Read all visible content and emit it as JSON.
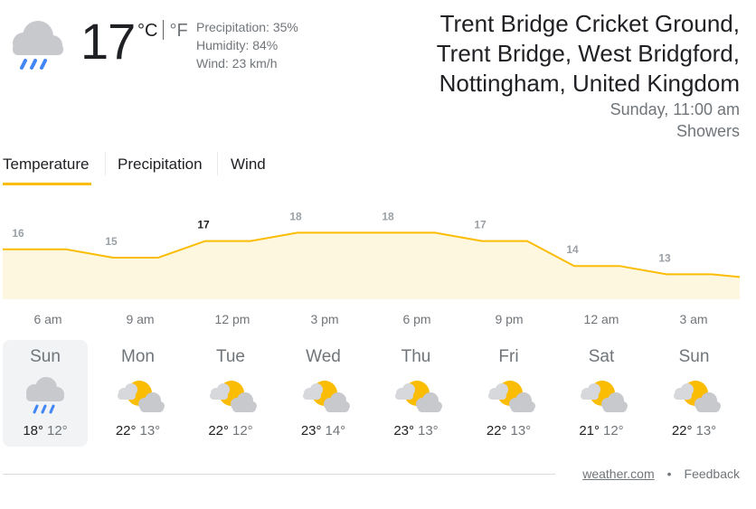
{
  "current": {
    "icon": "rain-cloud-icon",
    "temperature": "17",
    "unit_c": "°C",
    "unit_f": "°F",
    "precipitation": "Precipitation: 35%",
    "humidity": "Humidity: 84%",
    "wind": "Wind: 23 km/h"
  },
  "location": {
    "line1": "Trent Bridge Cricket Ground,",
    "line2": "Trent Bridge, West Bridgford,",
    "line3": "Nottingham, United Kingdom",
    "time": "Sunday, 11:00 am",
    "condition": "Showers"
  },
  "tabs": [
    {
      "label": "Temperature",
      "active": true
    },
    {
      "label": "Precipitation",
      "active": false
    },
    {
      "label": "Wind",
      "active": false
    }
  ],
  "chart_data": {
    "type": "area",
    "x": [
      "6 am",
      "9 am",
      "12 pm",
      "3 pm",
      "6 pm",
      "9 pm",
      "12 am",
      "3 am"
    ],
    "values": [
      16,
      15,
      17,
      18,
      18,
      17,
      14,
      13
    ],
    "value_labels": [
      "16",
      "15",
      "17",
      "18",
      "18",
      "17",
      "14",
      "13"
    ],
    "ylim": [
      10,
      19
    ],
    "line_color": "#fbbc04",
    "fill_color": "#fef7e0"
  },
  "forecast": [
    {
      "day": "Sun",
      "icon": "rain-cloud-icon",
      "high": "18°",
      "low": "12°",
      "selected": true
    },
    {
      "day": "Mon",
      "icon": "partly-sunny-icon",
      "high": "22°",
      "low": "13°",
      "selected": false
    },
    {
      "day": "Tue",
      "icon": "partly-sunny-icon",
      "high": "22°",
      "low": "12°",
      "selected": false
    },
    {
      "day": "Wed",
      "icon": "partly-sunny-icon",
      "high": "23°",
      "low": "14°",
      "selected": false
    },
    {
      "day": "Thu",
      "icon": "partly-sunny-icon",
      "high": "23°",
      "low": "13°",
      "selected": false
    },
    {
      "day": "Fri",
      "icon": "partly-sunny-icon",
      "high": "22°",
      "low": "13°",
      "selected": false
    },
    {
      "day": "Sat",
      "icon": "partly-sunny-icon",
      "high": "21°",
      "low": "12°",
      "selected": false
    },
    {
      "day": "Sun",
      "icon": "partly-sunny-icon",
      "high": "22°",
      "low": "13°",
      "selected": false
    }
  ],
  "footer": {
    "source": "weather.com",
    "separator": "•",
    "feedback": "Feedback"
  },
  "colors": {
    "accent": "#fbbc04",
    "text_primary": "#202124",
    "text_secondary": "#70757a"
  }
}
